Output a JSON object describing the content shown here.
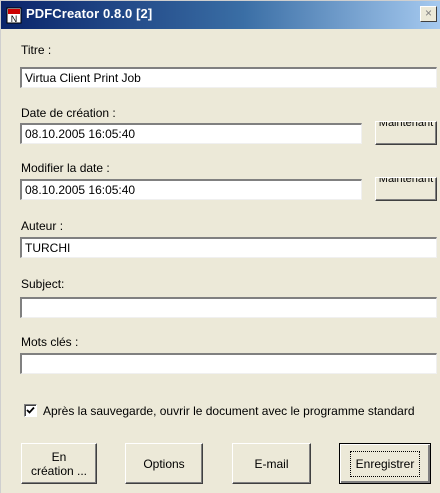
{
  "window": {
    "title": "PDFCreator 0.8.0 [2]",
    "close_label": "×"
  },
  "fields": {
    "title": {
      "label": "Titre :",
      "value": "Virtua Client Print Job"
    },
    "creation_date": {
      "label": "Date de création :",
      "value": "08.10.2005 16:05:40",
      "now_button": "Maintenant"
    },
    "modify_date": {
      "label": "Modifier la date :",
      "value": "08.10.2005 16:05:40",
      "now_button": "Maintenant"
    },
    "author": {
      "label": "Auteur :",
      "value": "TURCHI"
    },
    "subject": {
      "label": "Subject:",
      "value": ""
    },
    "keywords": {
      "label": "Mots clés :",
      "value": ""
    }
  },
  "open_after_save": {
    "checked": true,
    "label": "Après la sauvegarde, ouvrir le document avec le programme standard"
  },
  "buttons": {
    "waiting": "En création ...",
    "options": "Options",
    "email": "E-mail",
    "save": "Enregistrer"
  }
}
